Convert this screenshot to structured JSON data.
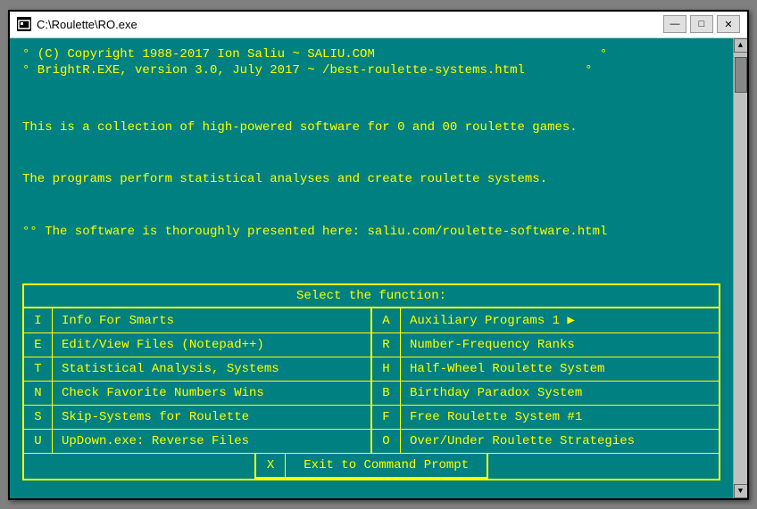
{
  "window": {
    "title": "C:\\Roulette\\RO.exe",
    "minimize_label": "—",
    "maximize_label": "□",
    "close_label": "✕"
  },
  "terminal": {
    "header1": "° (C) Copyright 1988-2017 Ion Saliu ~ SALIU.COM                              °",
    "header2": "° BrightR.EXE, version 3.0, July 2017 ~ /best-roulette-systems.html        °",
    "desc1": "This is a collection of high-powered software for 0 and 00 roulette games.",
    "desc2": "The programs perform statistical analyses and create roulette systems.",
    "desc3": "°° The software is thoroughly presented here: saliu.com/roulette-software.html",
    "menu_title": "Select the function:",
    "menu_items": [
      {
        "key": "I",
        "label": "Info For Smarts",
        "key2": "A",
        "label2": "Auxiliary Programs 1 ▶"
      },
      {
        "key": "E",
        "label": "Edit/View Files (Notepad++)",
        "key2": "R",
        "label2": "Number-Frequency Ranks"
      },
      {
        "key": "T",
        "label": "Statistical Analysis, Systems",
        "key2": "H",
        "label2": "Half-Wheel Roulette System"
      },
      {
        "key": "N",
        "label": "Check Favorite Numbers Wins",
        "key2": "B",
        "label2": "Birthday Paradox System"
      },
      {
        "key": "S",
        "label": "Skip-Systems for Roulette",
        "key2": "F",
        "label2": "Free Roulette System #1"
      },
      {
        "key": "U",
        "label": "UpDown.exe: Reverse Files",
        "key2": "O",
        "label2": "Over/Under Roulette Strategies"
      }
    ],
    "exit_key": "X",
    "exit_label": "Exit to Command Prompt"
  }
}
